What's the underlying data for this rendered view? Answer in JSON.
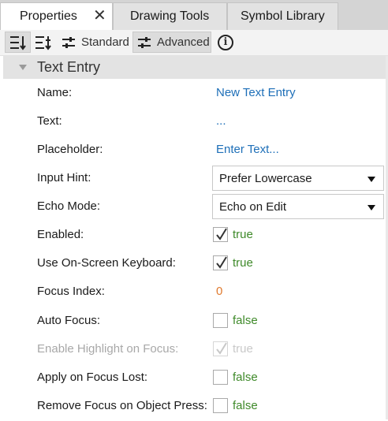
{
  "tabs": [
    {
      "label": "Properties",
      "active": true
    },
    {
      "label": "Drawing Tools",
      "active": false
    },
    {
      "label": "Symbol Library",
      "active": false
    }
  ],
  "close_glyph": "✕",
  "toolbar": {
    "standard_label": "Standard",
    "advanced_label": "Advanced",
    "info_glyph": "i"
  },
  "section": {
    "title": "Text Entry"
  },
  "properties": {
    "name": {
      "label": "Name:",
      "value": "New Text Entry"
    },
    "text": {
      "label": "Text:",
      "value": "..."
    },
    "placeholder": {
      "label": "Placeholder:",
      "value": "Enter Text..."
    },
    "input_hint": {
      "label": "Input Hint:",
      "value": "Prefer Lowercase"
    },
    "echo_mode": {
      "label": "Echo Mode:",
      "value": "Echo on Edit"
    },
    "enabled": {
      "label": "Enabled:",
      "value": "true",
      "checked": true
    },
    "use_onscreen_keyboard": {
      "label": "Use On-Screen Keyboard:",
      "value": "true",
      "checked": true
    },
    "focus_index": {
      "label": "Focus Index:",
      "value": "0"
    },
    "auto_focus": {
      "label": "Auto Focus:",
      "value": "false",
      "checked": false
    },
    "enable_highlight": {
      "label": "Enable Highlight on Focus:",
      "value": "true",
      "checked": true,
      "disabled": true
    },
    "apply_on_focus_lost": {
      "label": "Apply on Focus Lost:",
      "value": "false",
      "checked": false
    },
    "remove_focus": {
      "label": "Remove Focus on Object Press:",
      "value": "false",
      "checked": false
    }
  },
  "colors": {
    "link": "#1e6fb8",
    "number": "#e07a2e",
    "boolean": "#3f8a2a",
    "section_bg": "#e3e3e3",
    "tab_bar_bg": "#d4d4d4"
  }
}
